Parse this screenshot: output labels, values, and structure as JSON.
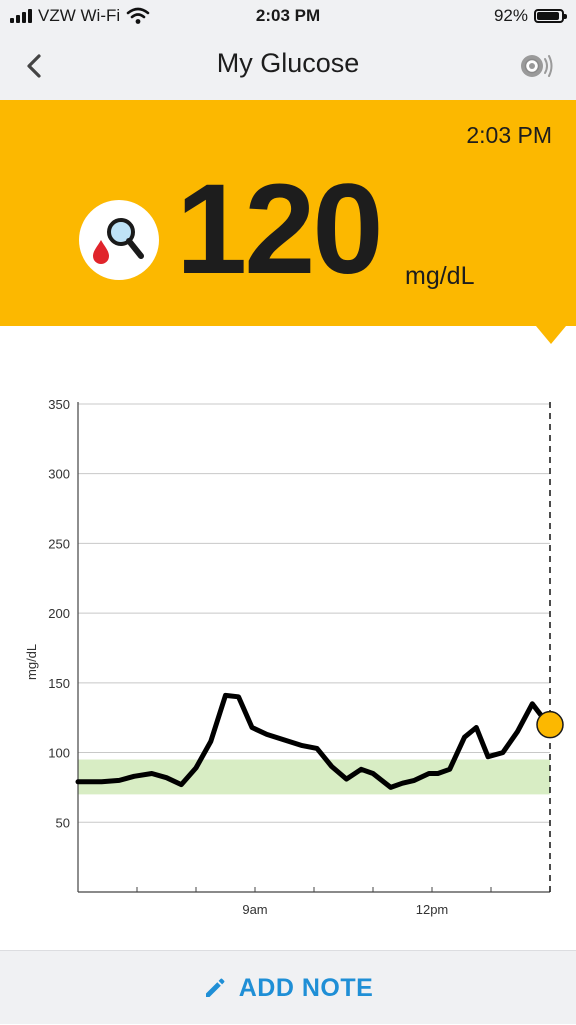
{
  "status_bar": {
    "carrier": "VZW Wi-Fi",
    "time": "2:03 PM",
    "battery": "92%",
    "battery_level": 0.92
  },
  "nav": {
    "title": "My Glucose"
  },
  "reading": {
    "time": "2:03 PM",
    "value": "120",
    "unit": "mg/dL",
    "banner_color": "#fcb800"
  },
  "actions": {
    "add_note_label": "ADD NOTE"
  },
  "colors": {
    "accent_blue": "#1f8fd6",
    "target_range": "#d8edc4",
    "current_marker": "#fcb800"
  },
  "chart_data": {
    "type": "line",
    "ylabel": "mg/dL",
    "ylim": [
      0,
      360
    ],
    "yticks": [
      50,
      100,
      150,
      200,
      250,
      300,
      350
    ],
    "xlim": [
      6,
      14
    ],
    "xticks": [
      {
        "value": 9,
        "label": "9am"
      },
      {
        "value": 12,
        "label": "12pm"
      }
    ],
    "minor_xticks": [
      7,
      8,
      10,
      11,
      13
    ],
    "target_range": [
      70,
      95
    ],
    "grid": true,
    "current_time_marker": 14,
    "series": [
      {
        "x": [
          6.0,
          6.4,
          6.7,
          6.95,
          7.25,
          7.5,
          7.75,
          8.0,
          8.25,
          8.5,
          8.72,
          8.95,
          9.2,
          9.5,
          9.8,
          10.05,
          10.3,
          10.55,
          10.8,
          11.0,
          11.3,
          11.5,
          11.7,
          11.95,
          12.1,
          12.3,
          12.55,
          12.75,
          12.95,
          13.2,
          13.45,
          13.7,
          13.88,
          14.0
        ],
        "y": [
          79,
          79,
          80,
          83,
          85,
          82,
          77,
          89,
          108,
          141,
          140,
          118,
          113,
          109,
          105,
          103,
          90,
          81,
          88,
          85,
          75,
          78,
          80,
          85,
          85,
          88,
          111,
          118,
          97,
          100,
          115,
          135,
          125,
          120
        ]
      }
    ]
  }
}
